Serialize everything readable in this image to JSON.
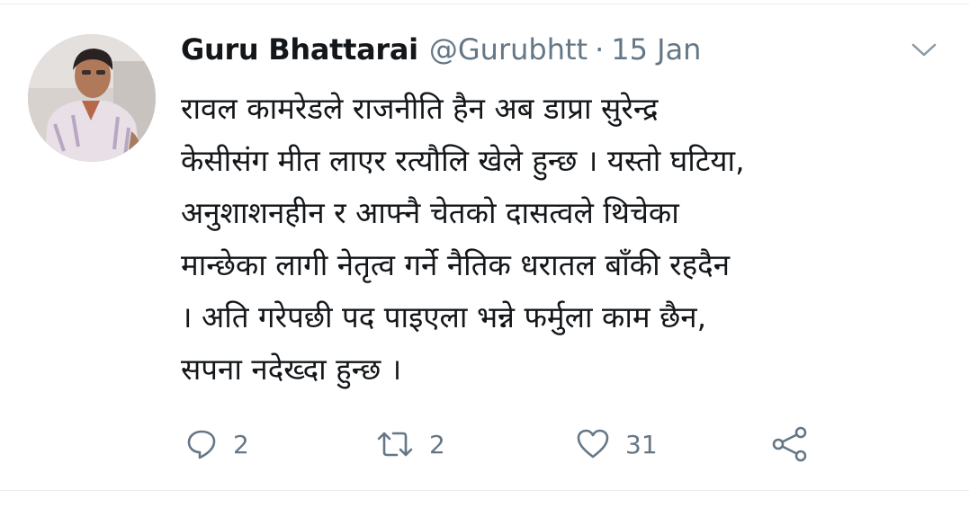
{
  "tweet": {
    "author_name": "Guru Bhattarai",
    "handle": "@Gurubhtt",
    "separator": "·",
    "date": "15 Jan",
    "text_lines": [
      "रावल कामरेडले राजनीति हैन अब डाप्रा सुरेन्द्र",
      "केसीसंग मीत लाएर रत्यौलि खेले हुन्छ । यस्तो घटिया,",
      "अनुशाशनहीन र आफ्नै चेतको दासत्वले थिचेका",
      "मान्छेका लागी नेतृत्व गर्ने नैतिक धरातल बाँकी रहदैन",
      "। अति गरेपछी पद पाइएला भन्ने फर्मुला काम छैन,",
      "सपना नदेख्दा हुन्छ ।"
    ]
  },
  "actions": {
    "reply": {
      "icon": "reply-icon",
      "count": "2"
    },
    "retweet": {
      "icon": "retweet-icon",
      "count": "2"
    },
    "like": {
      "icon": "heart-icon",
      "count": "31"
    },
    "share": {
      "icon": "share-icon"
    }
  },
  "colors": {
    "text": "#14171a",
    "secondary": "#657786",
    "divider": "#e6ecf0"
  }
}
